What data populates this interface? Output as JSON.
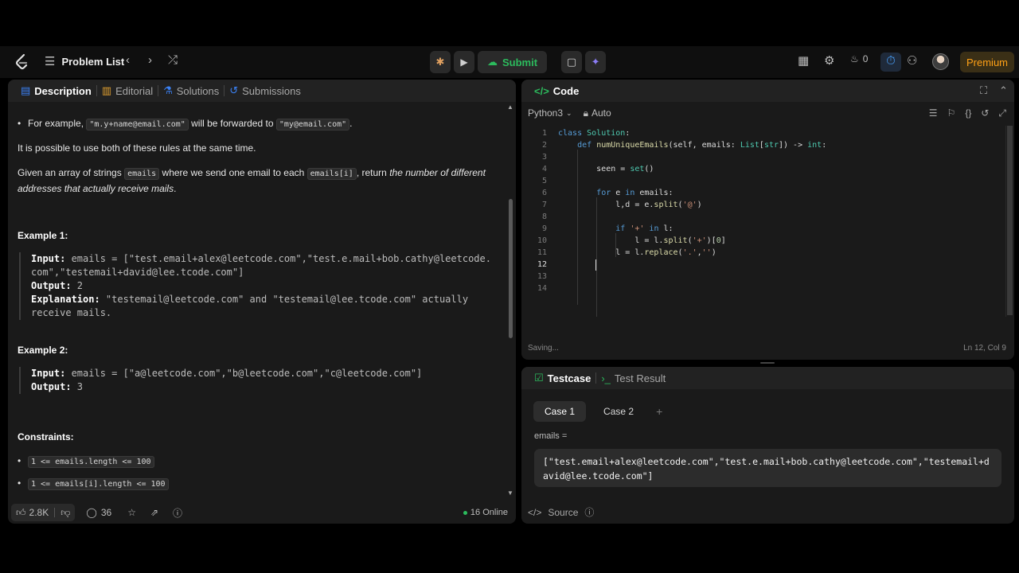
{
  "nav": {
    "problem_list": "Problem List",
    "submit": "Submit",
    "fire_count": "0",
    "premium": "Premium"
  },
  "left": {
    "tabs": [
      "Description",
      "Editorial",
      "Solutions",
      "Submissions"
    ],
    "bullet_example_prefix": "For example, ",
    "bullet_example_code1": "\"m.y+name@email.com\"",
    "bullet_example_mid": " will be forwarded to ",
    "bullet_example_code2": "\"my@email.com\"",
    "bullet_example_end": ".",
    "both_rules": "It is possible to use both of these rules at the same time.",
    "given_prefix": "Given an array of strings ",
    "given_code1": "emails",
    "given_mid": " where we send one email to each ",
    "given_code2": "emails[i]",
    "given_mid2": ", return ",
    "given_em": "the number of different addresses that actually receive mails",
    "given_end": ".",
    "example1_title": "Example 1:",
    "ex1_input_label": "Input:",
    "ex1_input": " emails = [\"test.email+alex@leetcode.com\",\"test.e.mail+bob.cathy@leetcode.com\",\"testemail+david@lee.tcode.com\"]",
    "ex1_output_label": "Output:",
    "ex1_output": " 2",
    "ex1_expl_label": "Explanation:",
    "ex1_expl": " \"testemail@leetcode.com\" and \"testemail@lee.tcode.com\" actually receive mails.",
    "example2_title": "Example 2:",
    "ex2_input_label": "Input:",
    "ex2_input": " emails = [\"a@leetcode.com\",\"b@leetcode.com\",\"c@leetcode.com\"]",
    "ex2_output_label": "Output:",
    "ex2_output": " 3",
    "constraints_title": "Constraints:",
    "constraint1": "1 <= emails.length <= 100",
    "constraint2": "1 <= emails[i].length <= 100",
    "likes": "2.8K",
    "comments": "36",
    "online": "16 Online"
  },
  "code": {
    "title": "Code",
    "language": "Python3",
    "auto": "Auto",
    "status_left": "Saving...",
    "status_right": "Ln 12, Col 9",
    "line_numbers": [
      "1",
      "2",
      "3",
      "4",
      "5",
      "6",
      "7",
      "8",
      "9",
      "10",
      "11",
      "12",
      "13",
      "14"
    ]
  },
  "test": {
    "tab_testcase": "Testcase",
    "tab_result": "Test Result",
    "case1": "Case 1",
    "case2": "Case 2",
    "add": "+",
    "emails_label": "emails =",
    "emails_value": "[\"test.email+alex@leetcode.com\",\"test.e.mail+bob.cathy@leetcode.com\",\"testemail+david@lee.tcode.com\"]",
    "source": "Source"
  },
  "colors": {
    "accent_green": "#2cbb5d",
    "premium_orange": "#ffa116",
    "tab_blue": "#3b82f6"
  }
}
